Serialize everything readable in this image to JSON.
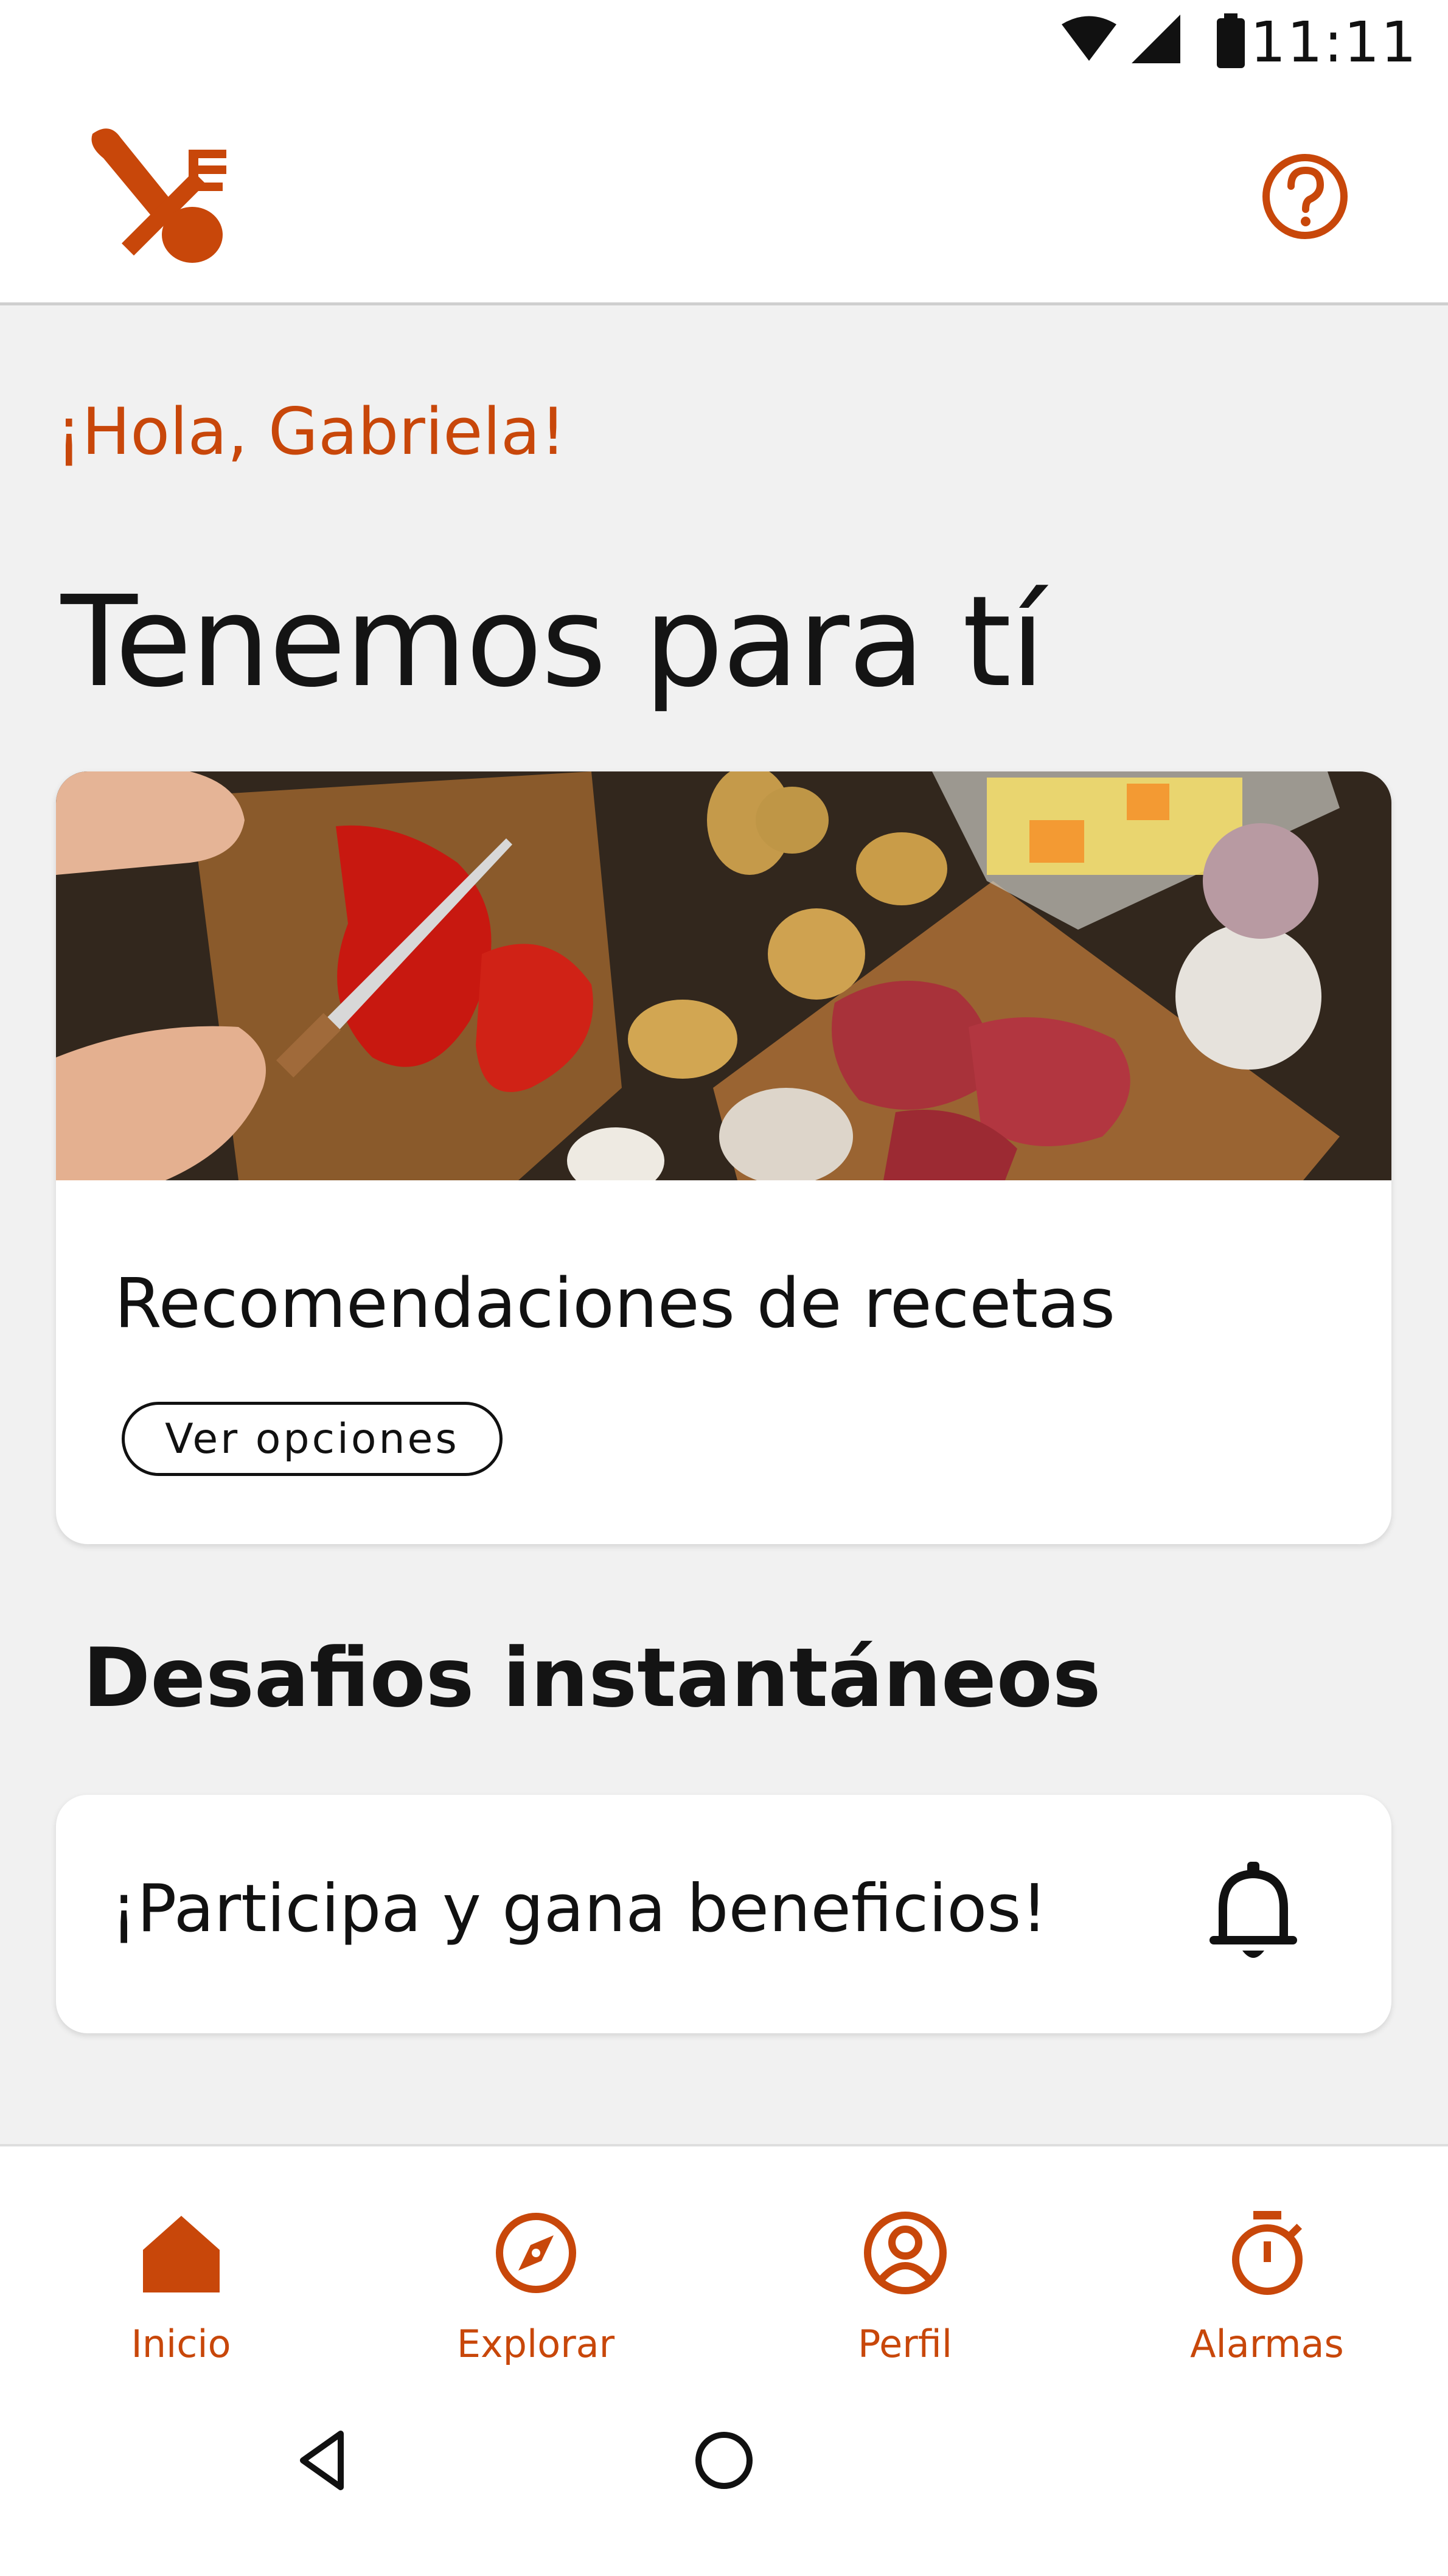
{
  "status_bar": {
    "time": "11:11",
    "icons": [
      "wifi-icon",
      "signal-icon",
      "battery-icon"
    ]
  },
  "header": {
    "logo_icon": "fork-spoon-logo",
    "help_icon": "help-circle-icon"
  },
  "greeting": "¡Hola, Gabriela!",
  "title": "Tenemos para tí",
  "recipe_card": {
    "image": "cutting-vegetables-and-meat-photo",
    "title": "Recomendaciones de recetas",
    "button_label": "Ver opciones"
  },
  "challenges": {
    "section_title": "Desafios instantáneos",
    "card_text": "¡Participa y gana beneficios!",
    "icon": "bell-icon"
  },
  "bottom_nav": {
    "items": [
      {
        "label": "Inicio",
        "icon": "home-icon",
        "active": true
      },
      {
        "label": "Explorar",
        "icon": "compass-icon",
        "active": false
      },
      {
        "label": "Perfil",
        "icon": "profile-icon",
        "active": false
      },
      {
        "label": "Alarmas",
        "icon": "stopwatch-icon",
        "active": false
      }
    ]
  },
  "system_nav": {
    "icons": [
      "back-icon",
      "home-circle-icon"
    ]
  },
  "colors": {
    "accent": "#c8470a",
    "background": "#f1f1f1",
    "card": "#ffffff",
    "text": "#141414"
  }
}
